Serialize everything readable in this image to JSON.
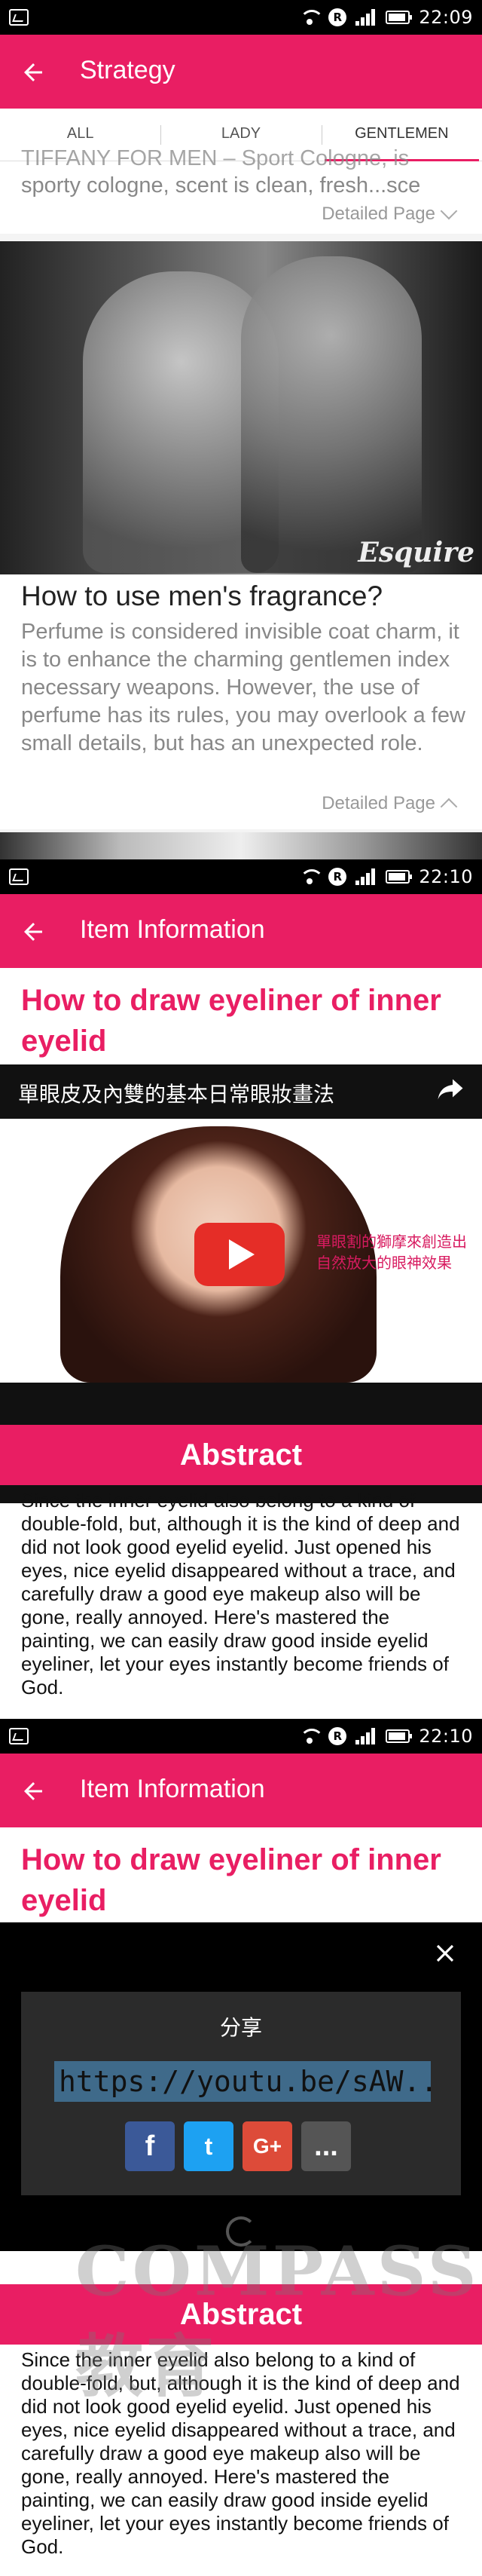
{
  "status_bar": {
    "time_1": "22:09",
    "time_2": "22:10",
    "time_3": "22:10",
    "r_badge": "R"
  },
  "screen1": {
    "title": "Strategy",
    "tabs": [
      "ALL",
      "LADY",
      "GENTLEMEN"
    ],
    "active_tab": "GENTLEMEN",
    "prev_card_text_faded": "TIFFANY FOR MEN – Sport Cologne, is",
    "prev_card_text": "sporty cologne, scent is clean, fresh...sce",
    "detail_label": "Detailed Page",
    "photo_watermark": "Esquire",
    "article_title": "How to use men's fragrance?",
    "article_body": "Perfume is considered invisible coat charm, it is to enhance the charming gentlemen index necessary weapons. However, the use of perfume has its rules, you may overlook a few small details, but has an unexpected role.",
    "article_detail_label": "Detailed Page"
  },
  "screen2": {
    "title": "Item Information",
    "item_title": "How to draw eyeliner of inner eyelid",
    "video_title": "單眼皮及內雙的基本日常眼妝畫法",
    "video_overlay_text": "單眼割的獅摩來創造出自然放大的眼神效果",
    "abstract_label": "Abstract",
    "abstract_text": "Since the inner eyelid also belong to a kind of double-fold, but, although it is the kind of deep and did not look good eyelid eyelid. Just opened his eyes, nice eyelid disappeared without a trace, and carefully draw a good eye makeup also will be gone, really annoyed. Here's mastered the painting, we can easily draw good inside eyelid eyeliner, let your eyes instantly become friends of God."
  },
  "screen3": {
    "title": "Item Information",
    "item_title": "How to draw eyeliner of inner eyelid",
    "share_label": "分享",
    "share_url": "https://youtu.be/sAW...",
    "share_icons": [
      "f",
      "t",
      "G+",
      "..."
    ],
    "abstract_label": "Abstract",
    "abstract_text": "Since the inner eyelid also belong to a kind of double-fold, but, although it is the kind of deep and did not look good eyelid eyelid. Just opened his eyes, nice eyelid disappeared without a trace, and carefully draw a good eye makeup also will be gone, really annoyed. Here's mastered the painting, we can easily draw good inside eyelid eyeliner, let your eyes instantly become friends of God.",
    "watermark": "COMPASS 教育"
  },
  "colors": {
    "accent": "#e91e63",
    "facebook": "#3b5998",
    "twitter": "#1da1f2",
    "googleplus": "#dd4b39",
    "more": "#555555"
  }
}
